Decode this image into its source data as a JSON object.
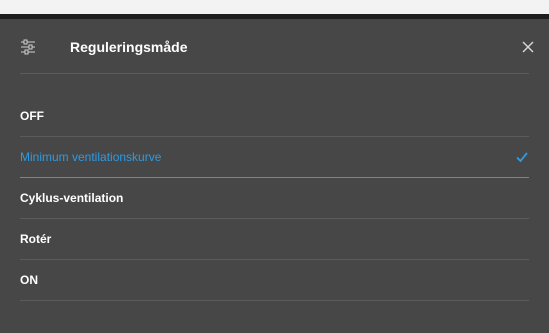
{
  "dialog": {
    "title": "Reguleringsmåde",
    "icons": {
      "settings": "sliders-icon",
      "close": "close-icon",
      "selected": "checkmark-icon"
    },
    "options": [
      {
        "label": "OFF",
        "selected": false
      },
      {
        "label": "Minimum ventilationskurve",
        "selected": true
      },
      {
        "label": "Cyklus-ventilation",
        "selected": false
      },
      {
        "label": "Rotér",
        "selected": false
      },
      {
        "label": "ON",
        "selected": false
      }
    ]
  },
  "colors": {
    "panel_bg": "#474747",
    "accent": "#2c9be5",
    "text": "#ffffff",
    "divider": "#5b5b5b"
  }
}
